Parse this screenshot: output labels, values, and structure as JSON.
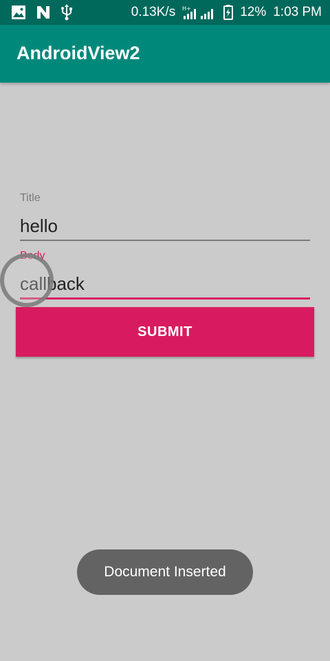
{
  "status_bar": {
    "icons_left": [
      "image-icon",
      "n-icon",
      "usb-icon"
    ],
    "network_speed": "0.13K/s",
    "network_type": "H+",
    "battery": "12%",
    "time": "1:03 PM"
  },
  "app_bar": {
    "title": "AndroidView2",
    "color": "#00897b"
  },
  "form": {
    "title_field": {
      "label": "Title",
      "value": "hello"
    },
    "body_field": {
      "label": "Body",
      "value": "callback"
    },
    "submit_label": "SUBMIT",
    "accent_color": "#d81b60"
  },
  "toast": {
    "message": "Document Inserted"
  }
}
